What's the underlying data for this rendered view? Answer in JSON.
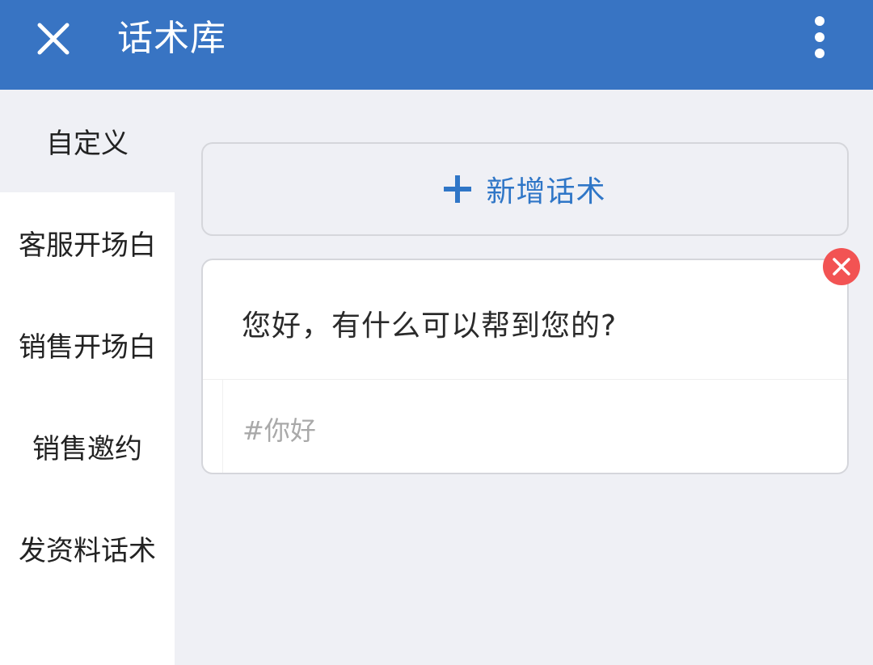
{
  "header": {
    "title": "话术库",
    "close_icon": "close-icon",
    "more_icon": "more-vertical-icon",
    "bg_color": "#3874c3"
  },
  "sidebar": {
    "items": [
      {
        "label": "自定义",
        "selected": true
      },
      {
        "label": "客服开场白",
        "selected": false
      },
      {
        "label": "销售开场白",
        "selected": false
      },
      {
        "label": "销售邀约",
        "selected": false
      },
      {
        "label": "发资料话术",
        "selected": false
      }
    ]
  },
  "main": {
    "add_button": {
      "label": "新增话术",
      "icon": "plus-icon",
      "color": "#2f76c7"
    },
    "scripts": [
      {
        "text": "您好，有什么可以帮到您的?",
        "tag": "#你好",
        "delete_icon": "delete-icon",
        "delete_color": "#f25353"
      }
    ]
  }
}
